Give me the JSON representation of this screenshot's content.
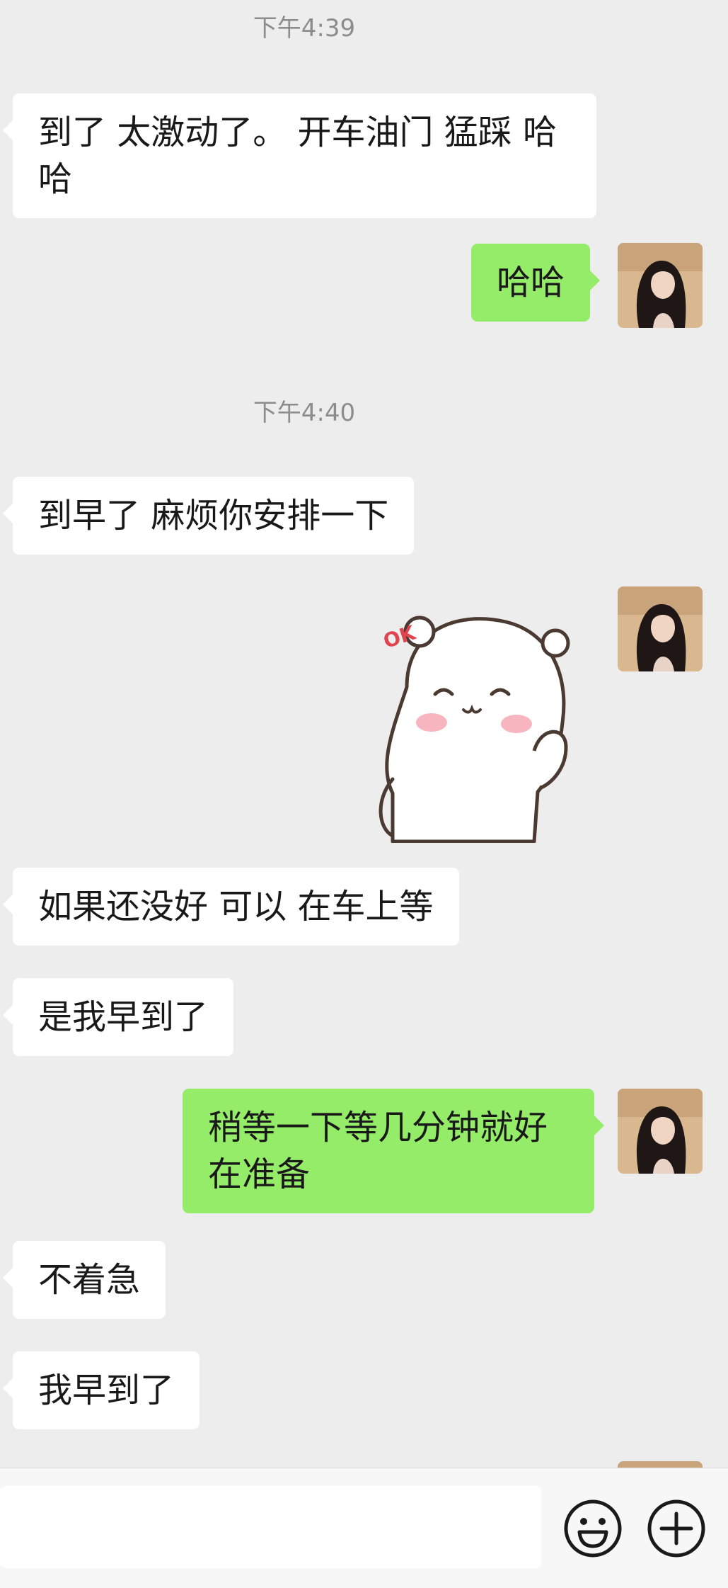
{
  "chat": {
    "messages": [
      {
        "type": "time",
        "text": "下午4:39"
      },
      {
        "type": "in",
        "text": "到了 太激动了。 开车油门 猛踩 哈哈"
      },
      {
        "type": "out",
        "text": "哈哈"
      },
      {
        "type": "time",
        "text": "下午4:40"
      },
      {
        "type": "in",
        "text": "到早了 麻烦你安排一下"
      },
      {
        "type": "out-sticker",
        "sticker": "bear-waving-ok",
        "sticker_text": "OK"
      },
      {
        "type": "in",
        "text": "如果还没好 可以 在车上等"
      },
      {
        "type": "in",
        "text": "是我早到了"
      },
      {
        "type": "out",
        "text": "稍等一下等几分钟就好在准备"
      },
      {
        "type": "in",
        "text": "不着急"
      },
      {
        "type": "in",
        "text": "我早到了"
      }
    ]
  },
  "input_bar": {
    "emoji_icon": "emoji-icon",
    "plus_icon": "plus-circle-icon"
  }
}
